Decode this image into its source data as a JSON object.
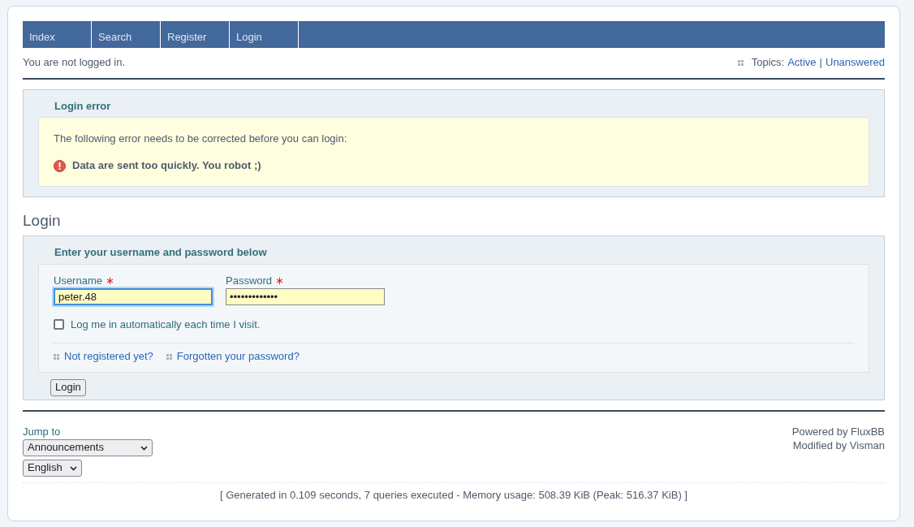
{
  "nav": [
    {
      "label": "Index"
    },
    {
      "label": "Search"
    },
    {
      "label": "Register"
    },
    {
      "label": "Login"
    }
  ],
  "status": {
    "text": "You are not logged in.",
    "topics_label": "Topics:",
    "links": [
      "Active",
      "Unanswered"
    ],
    "separator": "|"
  },
  "error_box": {
    "title": "Login error",
    "intro": "The following error needs to be corrected before you can login:",
    "errors": [
      "Data are sent too quickly. You robot ;)"
    ]
  },
  "login": {
    "heading": "Login",
    "legend": "Enter your username and password below",
    "fields": [
      {
        "label": "Username",
        "required_mark": "∗",
        "value": "peter.48",
        "focused": true
      },
      {
        "label": "Password",
        "required_mark": "∗",
        "value": "•••••••••••••",
        "focused": false
      }
    ],
    "remember": {
      "label": "Log me in automatically each time I visit.",
      "checked": false
    },
    "links": [
      "Not registered yet?",
      "Forgotten your password?"
    ],
    "submit": "Login"
  },
  "footer": {
    "jump_label": "Jump to",
    "jump_value": "Announcements",
    "language": "English",
    "credits": [
      "Powered by FluxBB",
      "Modified by Visman"
    ],
    "stats": "[ Generated in 0.109 seconds, 7 queries executed - Memory usage: 508.39 KiB (Peak: 516.37 KiB) ]"
  }
}
